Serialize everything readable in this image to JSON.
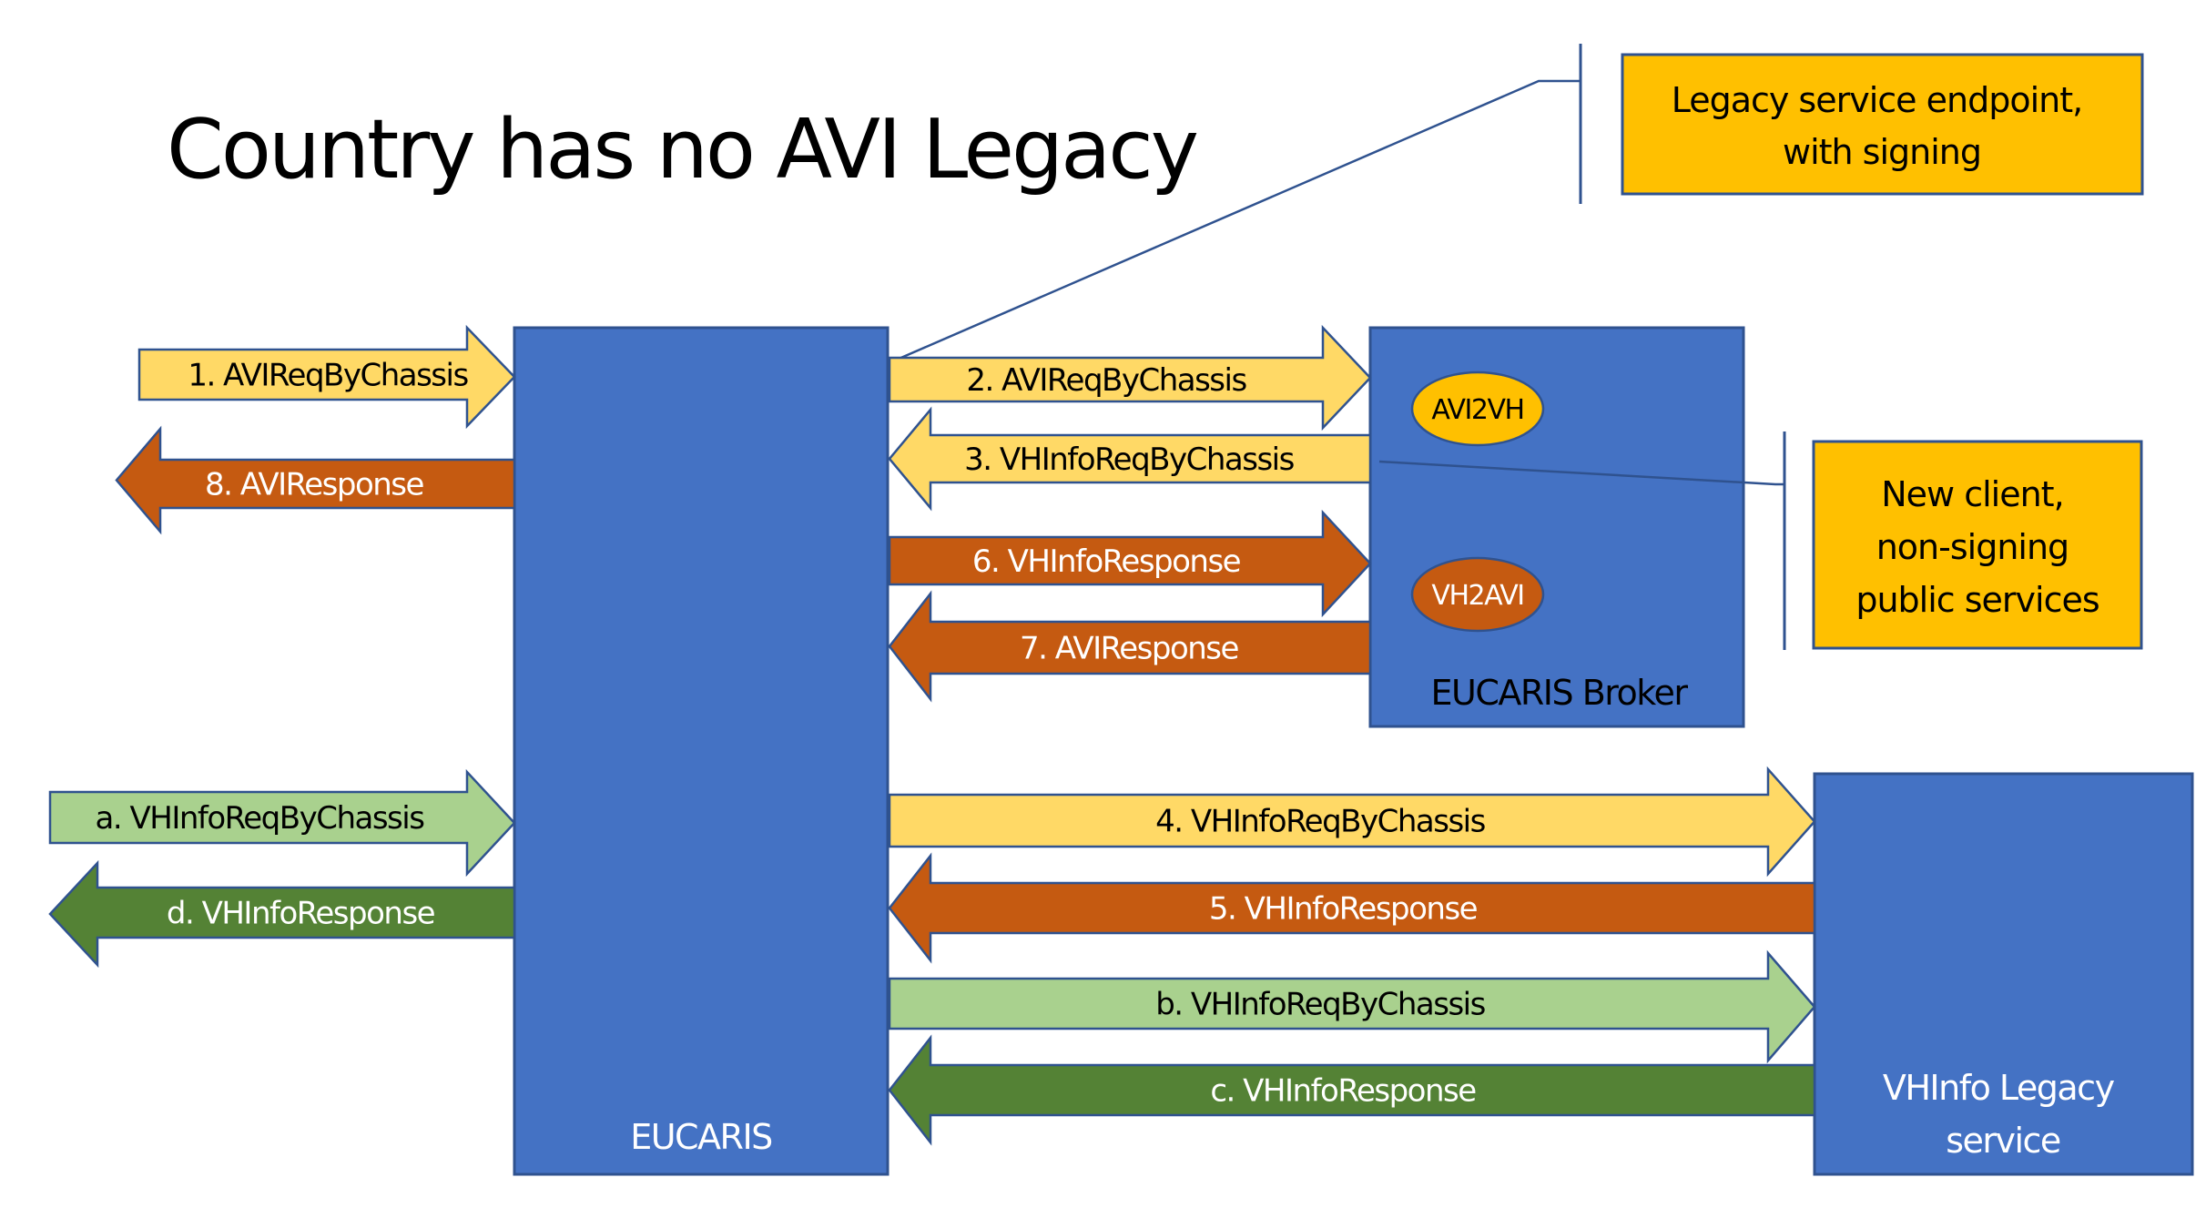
{
  "title": "Country has no AVI Legacy",
  "colors": {
    "box_blue": "#4472C4",
    "box_border": "#2F528F",
    "request_yellow": "#FFD966",
    "response_orange": "#C55A11",
    "request_green": "#A9D18E",
    "response_green": "#548235",
    "callout_gold": "#FFC000",
    "line_blue": "#2F528F"
  },
  "components": {
    "eucaris": "EUCARIS",
    "broker": "EUCARIS Broker",
    "vhinfo_legacy": [
      "VHInfo Legacy",
      "service"
    ]
  },
  "broker_functions": {
    "avi2vh": "AVI2VH",
    "vh2avi": "VH2AVI"
  },
  "callouts": {
    "legacy_endpoint": [
      "Legacy service endpoint,",
      "with signing"
    ],
    "new_client": [
      "New client,",
      "non-signing",
      "public services"
    ]
  },
  "arrows": [
    {
      "id": "1",
      "label": "1. AVIReqByChassis",
      "type": "request",
      "color": "yellow",
      "direction": "right",
      "from": "external",
      "to": "EUCARIS"
    },
    {
      "id": "8",
      "label": "8. AVIResponse",
      "type": "response",
      "color": "orange",
      "direction": "left",
      "from": "EUCARIS",
      "to": "external"
    },
    {
      "id": "2",
      "label": "2. AVIReqByChassis",
      "type": "request",
      "color": "yellow",
      "direction": "right",
      "from": "EUCARIS",
      "to": "EUCARIS Broker"
    },
    {
      "id": "3",
      "label": "3. VHInfoReqByChassis",
      "type": "request",
      "color": "yellow",
      "direction": "left",
      "from": "EUCARIS Broker",
      "to": "EUCARIS"
    },
    {
      "id": "6",
      "label": "6. VHInfoResponse",
      "type": "response",
      "color": "orange",
      "direction": "right",
      "from": "EUCARIS",
      "to": "EUCARIS Broker"
    },
    {
      "id": "7",
      "label": "7. AVIResponse",
      "type": "response",
      "color": "orange",
      "direction": "left",
      "from": "EUCARIS Broker",
      "to": "EUCARIS"
    },
    {
      "id": "a",
      "label": "a. VHInfoReqByChassis",
      "type": "request",
      "color": "light-green",
      "direction": "right",
      "from": "external",
      "to": "EUCARIS"
    },
    {
      "id": "d",
      "label": "d. VHInfoResponse",
      "type": "response",
      "color": "dark-green",
      "direction": "left",
      "from": "EUCARIS",
      "to": "external"
    },
    {
      "id": "4",
      "label": "4. VHInfoReqByChassis",
      "type": "request",
      "color": "yellow",
      "direction": "right",
      "from": "EUCARIS",
      "to": "VHInfo Legacy service"
    },
    {
      "id": "5",
      "label": "5. VHInfoResponse",
      "type": "response",
      "color": "orange",
      "direction": "left",
      "from": "VHInfo Legacy service",
      "to": "EUCARIS"
    },
    {
      "id": "b",
      "label": "b. VHInfoReqByChassis",
      "type": "request",
      "color": "light-green",
      "direction": "right",
      "from": "EUCARIS",
      "to": "VHInfo Legacy service"
    },
    {
      "id": "c",
      "label": "c. VHInfoResponse",
      "type": "response",
      "color": "dark-green",
      "direction": "left",
      "from": "VHInfo Legacy service",
      "to": "EUCARIS"
    }
  ]
}
